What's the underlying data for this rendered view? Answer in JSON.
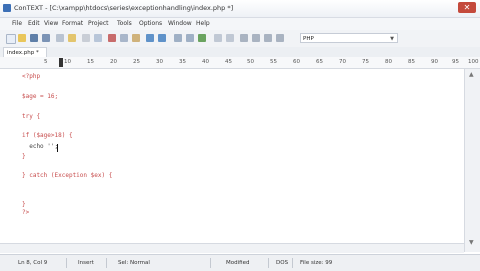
{
  "window": {
    "title": "ConTEXT - [C:\\xampp\\htdocs\\series\\exceptionhandling\\index.php *]",
    "close_glyph": "✕"
  },
  "menu": [
    "File",
    "Edit",
    "View",
    "Format",
    "Project",
    "Tools",
    "Options",
    "Window",
    "Help"
  ],
  "toolbar": {
    "syntax_value": "PHP",
    "syntax_arrow": "▼"
  },
  "tabs": [
    {
      "label": "index.php *"
    }
  ],
  "ruler": {
    "labels": [
      "5",
      "10",
      "15",
      "20",
      "25",
      "30",
      "35",
      "40",
      "45",
      "50",
      "55",
      "60",
      "65",
      "70",
      "75",
      "80",
      "85",
      "90",
      "95",
      "100"
    ]
  },
  "code_lines": [
    "<?php",
    "",
    "$age = 16;",
    "",
    "try {",
    "",
    "if ($age>18) {",
    "  echo '';",
    "}",
    "",
    "} catch (Exception $ex) {",
    "",
    "",
    "}",
    "",
    "?>"
  ],
  "status": {
    "position": "Ln 8, Col 9",
    "insert_mode": "Insert",
    "selection_mode": "Sel: Normal",
    "modified": "Modified",
    "line_ending": "DOS",
    "file_size": "File size: 99"
  }
}
